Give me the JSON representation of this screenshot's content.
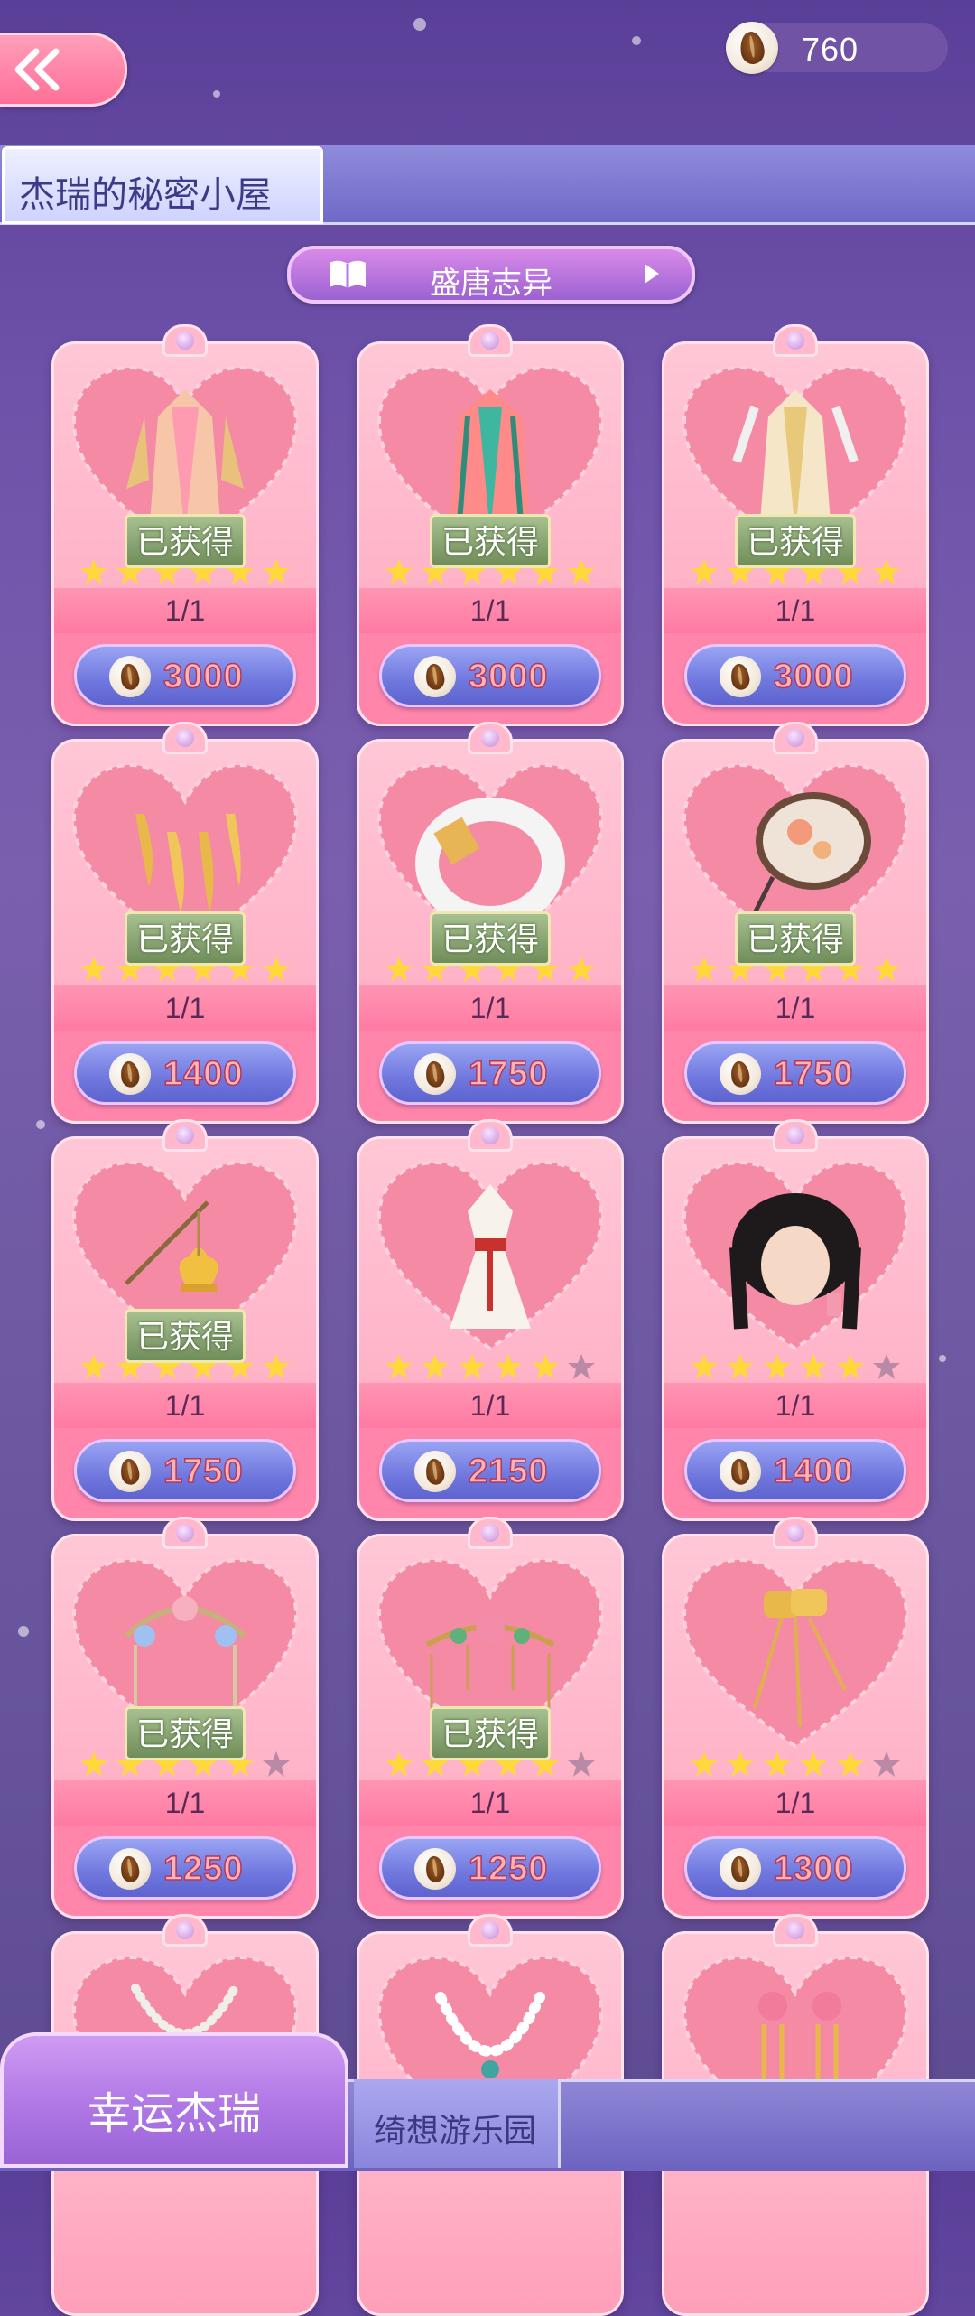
{
  "topbar": {
    "back_icon": "double-chevron-left-icon",
    "currency_amount": "760",
    "currency_icon": "seed-coin-icon"
  },
  "title_tab": {
    "label": "杰瑞的秘密小屋"
  },
  "series": {
    "label": "盛唐志异",
    "book_icon": "book-icon",
    "next_icon": "play-arrow-icon"
  },
  "obtained_text": "已获得",
  "items": [
    {
      "art": "pink-hanfu-gown",
      "stars_filled": 6,
      "stars_total": 6,
      "stock": "1/1",
      "price": "3000",
      "obtained": true
    },
    {
      "art": "teal-hanfu-gown",
      "stars_filled": 6,
      "stars_total": 6,
      "stock": "1/1",
      "price": "3000",
      "obtained": true
    },
    {
      "art": "cream-hanfu-gown",
      "stars_filled": 6,
      "stars_total": 6,
      "stock": "1/1",
      "price": "3000",
      "obtained": true
    },
    {
      "art": "gold-nail-guards",
      "stars_filled": 6,
      "stars_total": 6,
      "stock": "1/1",
      "price": "1400",
      "obtained": true
    },
    {
      "art": "jade-bangle",
      "stars_filled": 6,
      "stars_total": 6,
      "stock": "1/1",
      "price": "1750",
      "obtained": true
    },
    {
      "art": "round-fan",
      "stars_filled": 6,
      "stars_total": 6,
      "stock": "1/1",
      "price": "1750",
      "obtained": true
    },
    {
      "art": "lotus-hairpin",
      "stars_filled": 6,
      "stars_total": 6,
      "stock": "1/1",
      "price": "1750",
      "obtained": true
    },
    {
      "art": "white-red-dress",
      "stars_filled": 5,
      "stars_total": 6,
      "stock": "1/1",
      "price": "2150",
      "obtained": false
    },
    {
      "art": "black-braided-hair",
      "stars_filled": 5,
      "stars_total": 6,
      "stock": "1/1",
      "price": "1400",
      "obtained": false
    },
    {
      "art": "flower-headdress",
      "stars_filled": 5,
      "stars_total": 6,
      "stock": "1/1",
      "price": "1250",
      "obtained": true
    },
    {
      "art": "floral-tiara",
      "stars_filled": 5,
      "stars_total": 6,
      "stock": "1/1",
      "price": "1250",
      "obtained": true
    },
    {
      "art": "gold-earrings",
      "stars_filled": 5,
      "stars_total": 6,
      "stock": "1/1",
      "price": "1300",
      "obtained": false
    },
    {
      "art": "pearl-necklace",
      "partial": true
    },
    {
      "art": "bead-necklace",
      "partial": true
    },
    {
      "art": "pink-flower-earrings",
      "partial": true
    }
  ],
  "bottom_tabs": [
    {
      "label": "幸运杰瑞",
      "active": true
    },
    {
      "label": "绮想游乐园",
      "active": false
    }
  ],
  "colors": {
    "accent_pink": "#ff86aa",
    "price_blue": "#6f77de",
    "star_gold": "#ffd93a",
    "star_empty": "#b98aa5",
    "badge_green": "#6f8d5a"
  }
}
